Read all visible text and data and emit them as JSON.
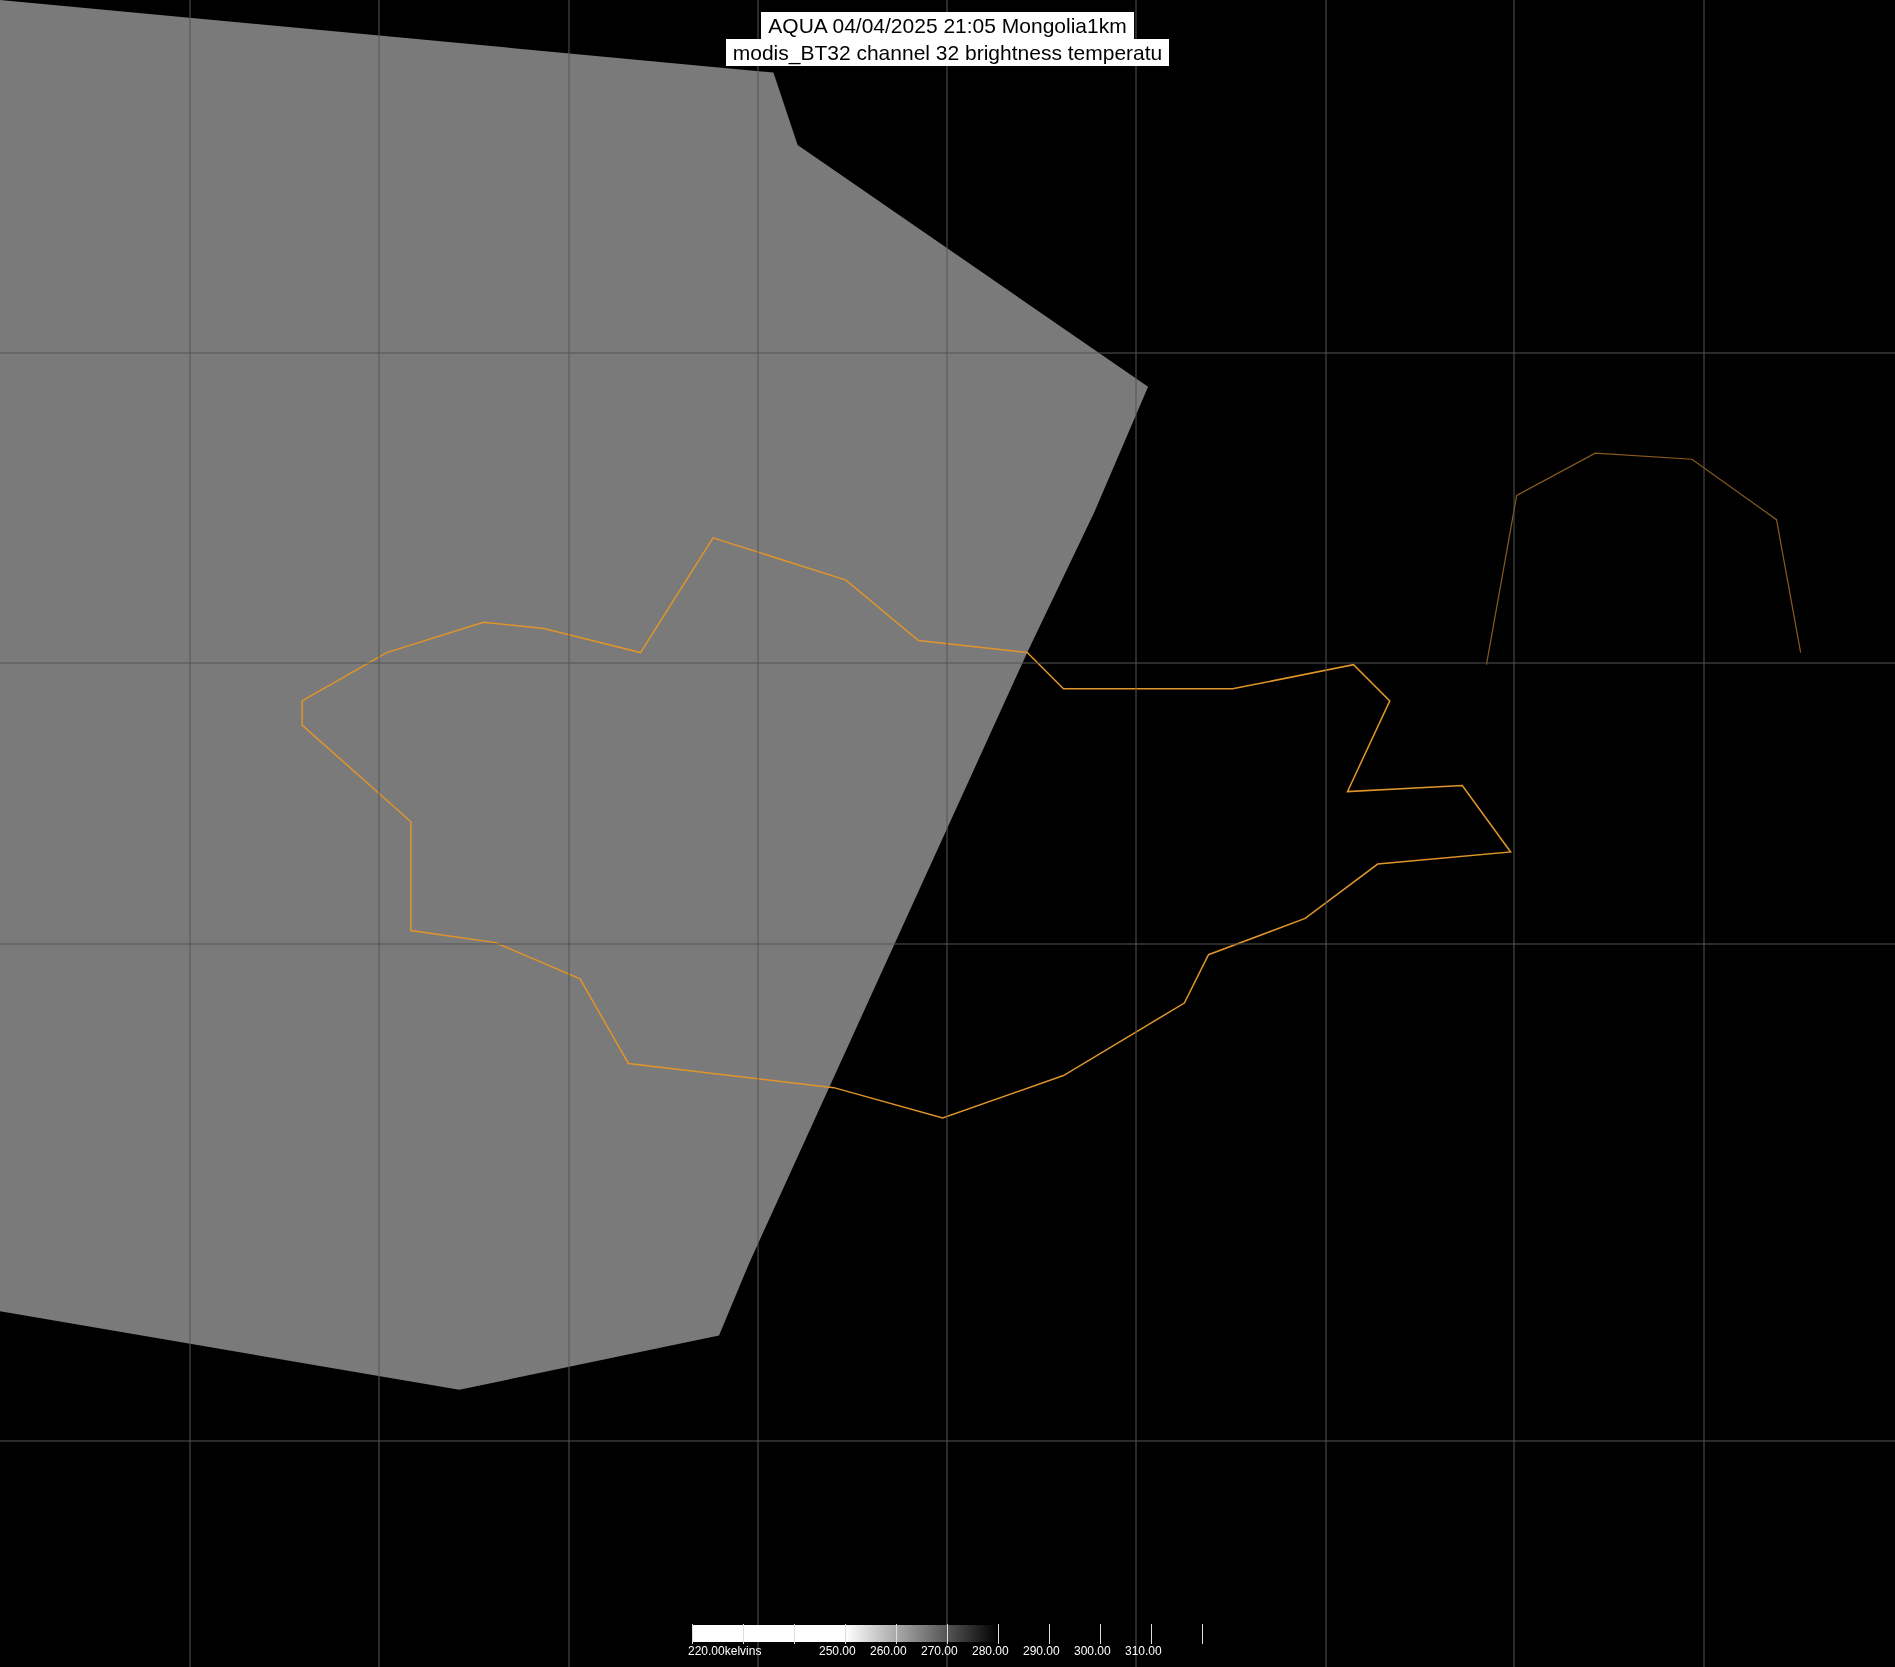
{
  "title": {
    "line_1": "AQUA 04/04/2025 21:05 Mongolia1km",
    "line_2": "modis_BT32 channel 32 brightness temperatu"
  },
  "colorbar": {
    "first_label": "220.00kelvins",
    "tick_labels": [
      "250.00",
      "260.00",
      "270.00",
      "280.00",
      "290.00",
      "300.00",
      "310.00"
    ]
  }
}
